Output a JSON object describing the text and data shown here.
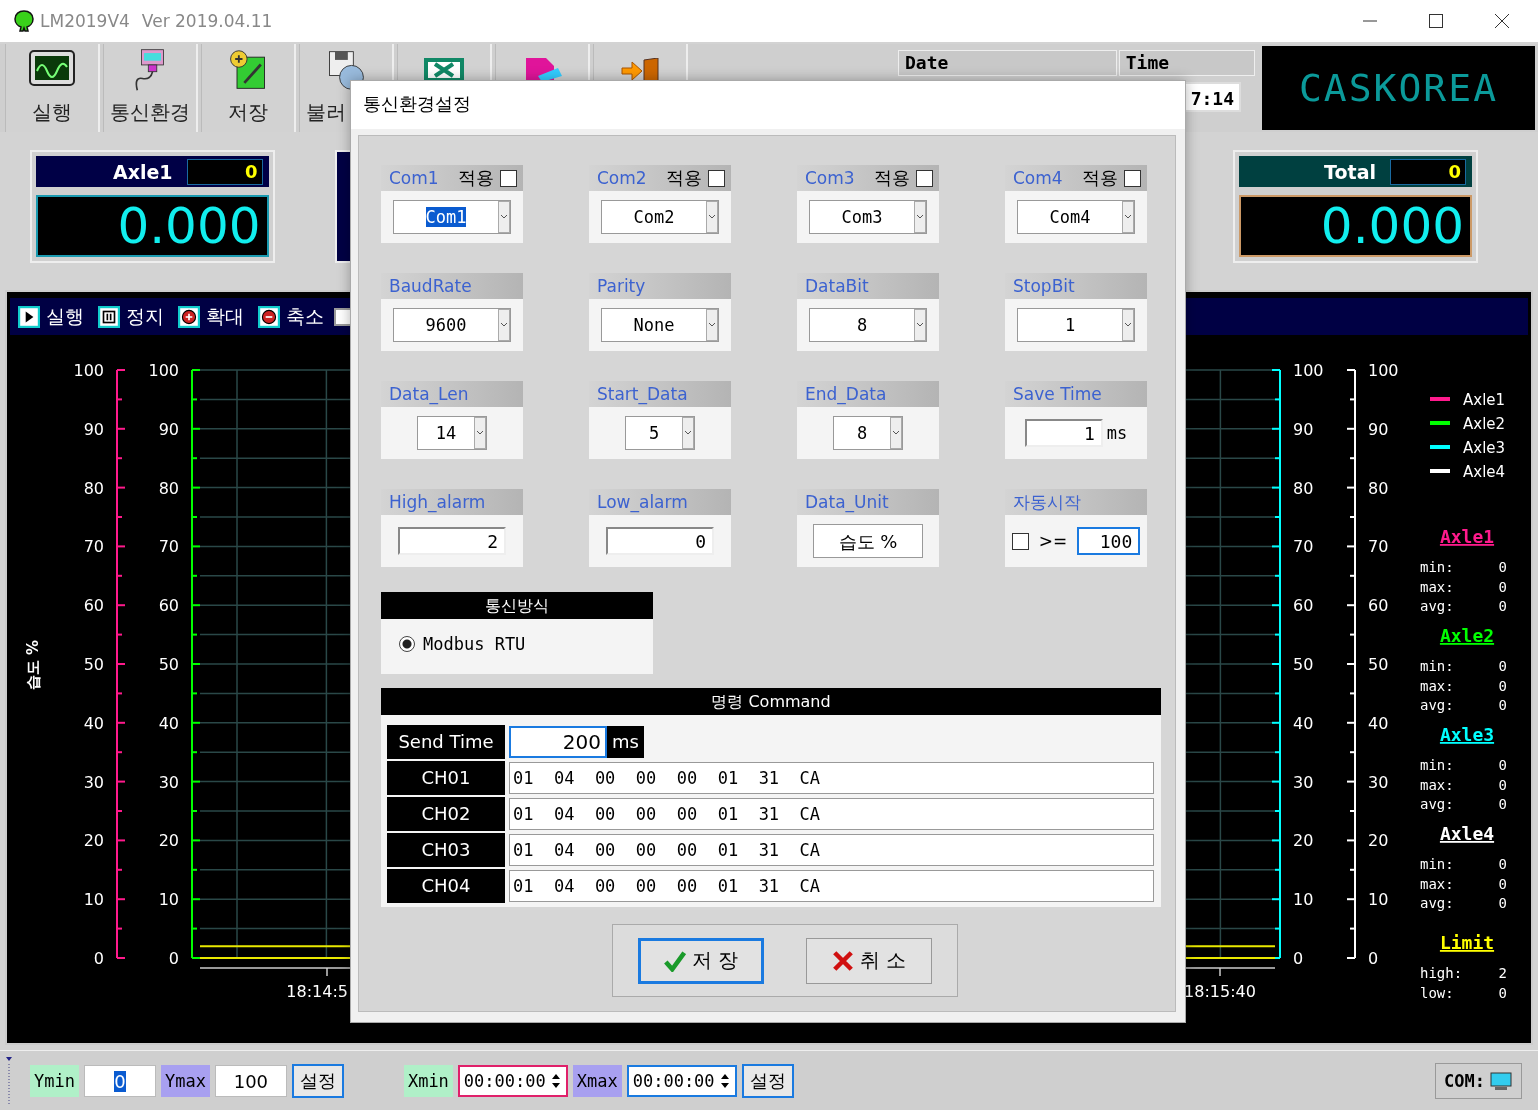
{
  "window": {
    "title": "LM2019V4",
    "version": "Ver 2019.04.11"
  },
  "toolbar": {
    "buttons": [
      "실행",
      "통신환경",
      "저장",
      "불러"
    ]
  },
  "clock": {
    "date_label": "Date",
    "time_label": "Time",
    "time": "7:14"
  },
  "brand": "CASKOREA",
  "readouts": [
    {
      "kind": "axle",
      "name": "Axle1",
      "count": "0",
      "value": "0.000"
    },
    {
      "kind": "total",
      "name": "Total",
      "count": "0",
      "value": "0.000"
    }
  ],
  "chart_toolbar": [
    "실행",
    "정지",
    "확대",
    "축소"
  ],
  "chart_checkbox": {
    "checked": false
  },
  "chart": {
    "ylabel": "습도 %",
    "xticks": [
      "18:14:5",
      "18:15:40"
    ],
    "y_axes": [
      {
        "ticks": [
          "100",
          "90",
          "80",
          "70",
          "60",
          "50",
          "40",
          "30",
          "20",
          "10",
          "0"
        ]
      },
      {
        "ticks": [
          "100",
          "90",
          "80",
          "70",
          "60",
          "50",
          "40",
          "30",
          "20",
          "10",
          "0"
        ]
      },
      {
        "ticks": [
          "100",
          "90",
          "80",
          "70",
          "60",
          "50",
          "40",
          "30",
          "20",
          "10",
          "0"
        ]
      },
      {
        "ticks": [
          "100",
          "90",
          "80",
          "70",
          "60",
          "50",
          "40",
          "30",
          "20",
          "10",
          "0"
        ]
      }
    ],
    "legend": [
      {
        "name": "Axle1",
        "color": "#ff1a8c"
      },
      {
        "name": "Axle2",
        "color": "#00ff00"
      },
      {
        "name": "Axle3",
        "color": "#00ffff"
      },
      {
        "name": "Axle4",
        "color": "#ffffff"
      }
    ],
    "stats": [
      {
        "title": "Axle1",
        "rows": [
          {
            "label": "min:",
            "value": "0"
          },
          {
            "label": "max:",
            "value": "0"
          },
          {
            "label": "avg:",
            "value": "0"
          }
        ]
      },
      {
        "title": "Axle2",
        "rows": [
          {
            "label": "min:",
            "value": "0"
          },
          {
            "label": "max:",
            "value": "0"
          },
          {
            "label": "avg:",
            "value": "0"
          }
        ]
      },
      {
        "title": "Axle3",
        "rows": [
          {
            "label": "min:",
            "value": "0"
          },
          {
            "label": "max:",
            "value": "0"
          },
          {
            "label": "avg:",
            "value": "0"
          }
        ]
      },
      {
        "title": "Axle4",
        "rows": [
          {
            "label": "min:",
            "value": "0"
          },
          {
            "label": "max:",
            "value": "0"
          },
          {
            "label": "avg:",
            "value": "0"
          }
        ]
      }
    ],
    "limit": {
      "title": "Limit",
      "rows": [
        {
          "label": "high:",
          "value": "2"
        },
        {
          "label": "low:",
          "value": "0"
        }
      ]
    }
  },
  "bottom_bar": {
    "ymin_label": "Ymin",
    "ymin": "0",
    "ymax_label": "Ymax",
    "ymax": "100",
    "set_y": "설정",
    "xmin_label": "Xmin",
    "xmin": "00:00:00",
    "xmax_label": "Xmax",
    "xmax": "00:00:00",
    "set_x": "설정",
    "com": "COM:"
  },
  "dialog": {
    "title": "통신환경설정",
    "ports": [
      {
        "label": "Com1",
        "apply_label": "적용",
        "apply": false,
        "value": "Com1",
        "highlighted": true
      },
      {
        "label": "Com2",
        "apply_label": "적용",
        "apply": false,
        "value": "Com2",
        "highlighted": false
      },
      {
        "label": "Com3",
        "apply_label": "적용",
        "apply": false,
        "value": "Com3",
        "highlighted": false
      },
      {
        "label": "Com4",
        "apply_label": "적용",
        "apply": false,
        "value": "Com4",
        "highlighted": false
      }
    ],
    "fields": [
      {
        "kind": "dropdown",
        "label": "BaudRate",
        "value": "9600"
      },
      {
        "kind": "dropdown",
        "label": "Parity",
        "value": "None"
      },
      {
        "kind": "dropdown",
        "label": "DataBit",
        "value": "8"
      },
      {
        "kind": "dropdown",
        "label": "StopBit",
        "value": "1"
      },
      {
        "kind": "spinner",
        "label": "Data_Len",
        "value": "14"
      },
      {
        "kind": "spinner",
        "label": "Start_Data",
        "value": "5"
      },
      {
        "kind": "spinner",
        "label": "End_Data",
        "value": "8"
      },
      {
        "kind": "input",
        "label": "Save Time",
        "value": "1",
        "unit": "ms"
      },
      {
        "kind": "input",
        "label": "High_alarm",
        "value": "2"
      },
      {
        "kind": "input",
        "label": "Low_alarm",
        "value": "0"
      },
      {
        "kind": "display",
        "label": "Data_Unit",
        "value": "습도 %"
      },
      {
        "kind": "autostart",
        "label": "자동시작",
        "checked": false,
        "operator": ">=",
        "value": "100"
      }
    ],
    "protocol": {
      "title": "통신방식",
      "options": [
        {
          "label": "Modbus RTU",
          "selected": true
        }
      ]
    },
    "command": {
      "title": "명령 Command",
      "send_time_label": "Send Time",
      "send_time": "200",
      "unit": "ms",
      "channels": [
        {
          "name": "CH01",
          "value": "01  04  00  00  00  01  31  CA"
        },
        {
          "name": "CH02",
          "value": "01  04  00  00  00  01  31  CA"
        },
        {
          "name": "CH03",
          "value": "01  04  00  00  00  01  31  CA"
        },
        {
          "name": "CH04",
          "value": "01  04  00  00  00  01  31  CA"
        }
      ]
    },
    "buttons": [
      {
        "kind": "save",
        "label": "저 장",
        "focused": true
      },
      {
        "kind": "cancel",
        "label": "취 소",
        "focused": false
      }
    ]
  }
}
